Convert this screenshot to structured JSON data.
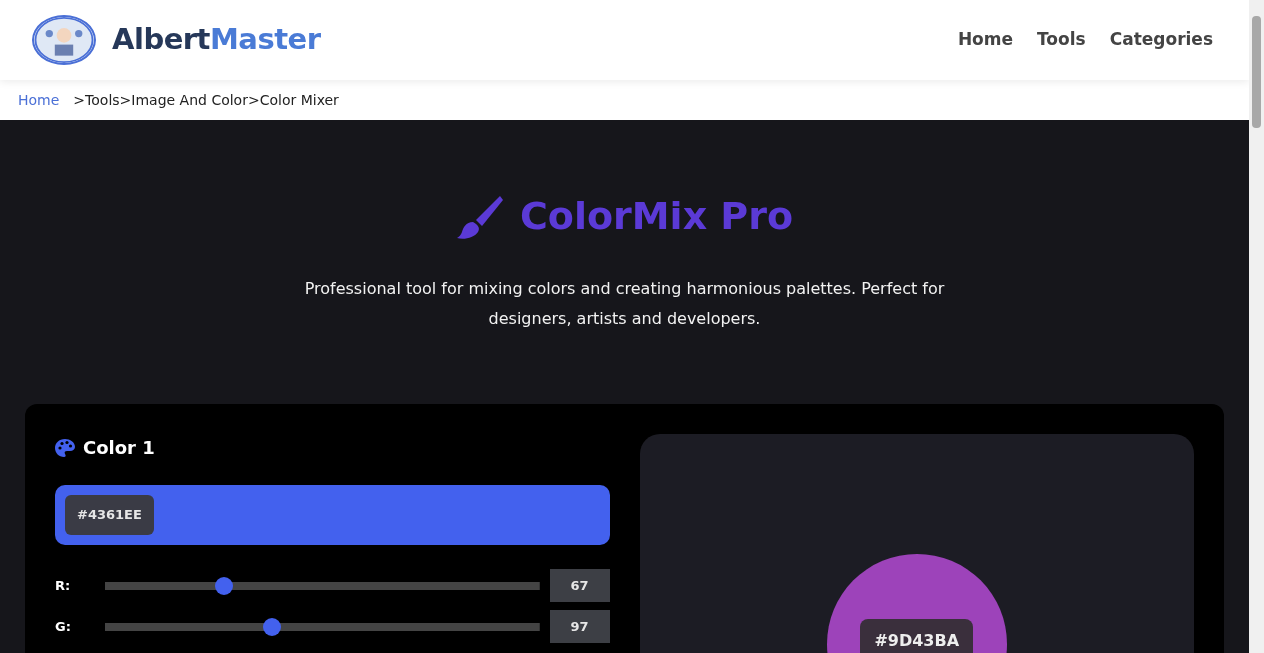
{
  "header": {
    "logo_text_dark": "Albert",
    "logo_text_light": "Master",
    "nav": [
      {
        "label": "Home"
      },
      {
        "label": "Tools"
      },
      {
        "label": "Categories"
      }
    ]
  },
  "breadcrumb": [
    {
      "label": "Home",
      "kind": "link"
    },
    {
      "label": ">Tools",
      "kind": "text"
    },
    {
      "label": ">Image And Color",
      "kind": "text"
    },
    {
      "label": ">Color Mixer",
      "kind": "text"
    }
  ],
  "hero": {
    "title": "ColorMix Pro",
    "subtitle": "Professional tool for mixing colors and creating harmonious palettes. Perfect for designers, artists and developers."
  },
  "color1": {
    "title": "Color 1",
    "hex": "#4361EE",
    "color": "#4361ee",
    "channels": [
      {
        "label": "R:",
        "level": 0.263,
        "value": "67"
      },
      {
        "label": "G:",
        "level": 0.38,
        "value": "97"
      }
    ]
  },
  "result": {
    "hex": "#9D43BA",
    "color": "#9d43ba"
  }
}
